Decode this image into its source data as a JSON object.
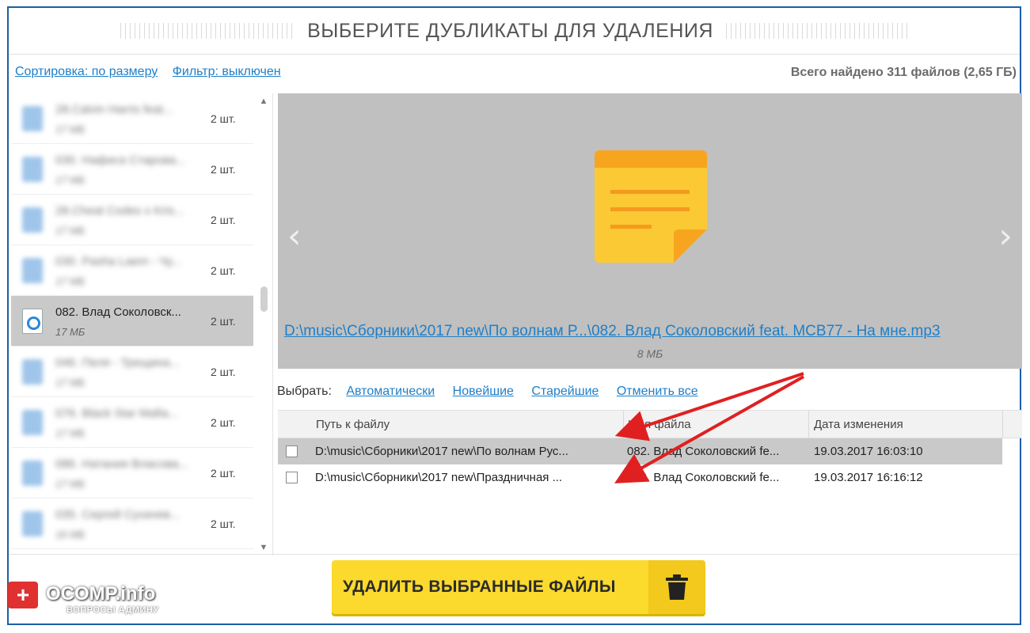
{
  "header": {
    "title": "ВЫБЕРИТЕ ДУБЛИКАТЫ ДЛЯ УДАЛЕНИЯ"
  },
  "toolbar": {
    "sort_link": "Сортировка: по размеру",
    "filter_link": "Фильтр: выключен",
    "total": "Всего найдено 311 файлов (2,65 ГБ)"
  },
  "list": {
    "items": [
      {
        "name": "28.Calvin Harris feat...",
        "size": "17 МБ",
        "count": "2 шт.",
        "blurred": true
      },
      {
        "name": "030. Нафиса Старова...",
        "size": "17 МБ",
        "count": "2 шт.",
        "blurred": true
      },
      {
        "name": "28.Cheat Codes x Kris...",
        "size": "17 МБ",
        "count": "2 шт.",
        "blurred": true
      },
      {
        "name": "030. Pasha Laem - Чу...",
        "size": "17 МБ",
        "count": "2 шт.",
        "blurred": true
      },
      {
        "name": "082. Влад Соколовск...",
        "size": "17 МБ",
        "count": "2 шт.",
        "blurred": false
      },
      {
        "name": "046. Пеля - Трещина...",
        "size": "17 МБ",
        "count": "2 шт.",
        "blurred": true
      },
      {
        "name": "076. Black Star Mafia...",
        "size": "17 МБ",
        "count": "2 шт.",
        "blurred": true
      },
      {
        "name": "086. Натания Власова...",
        "size": "17 МБ",
        "count": "2 шт.",
        "blurred": true
      },
      {
        "name": "035. Сергей Сухачев...",
        "size": "16 МБ",
        "count": "2 шт.",
        "blurred": true
      }
    ],
    "selected_index": 4
  },
  "preview": {
    "path": "D:\\music\\Сборники\\2017 new\\По волнам Р...\\082. Влад Соколовский feat. MCB77 - На мне.mp3",
    "size": "8 МБ",
    "icon": "note-icon"
  },
  "select_bar": {
    "label": "Выбрать:",
    "auto": "Автоматически",
    "newest": "Новейшие",
    "oldest": "Старейшие",
    "cancel": "Отменить все"
  },
  "table": {
    "columns": [
      "Путь к файлу",
      "Имя файла",
      "Дата изменения"
    ],
    "rows": [
      {
        "path": "D:\\music\\Сборники\\2017 new\\По волнам Рус...",
        "name": "082. Влад Соколовский fe...",
        "date": "19.03.2017 16:03:10",
        "checked": false
      },
      {
        "path": "D:\\music\\Сборники\\2017 new\\Праздничная ...",
        "name": "082. Влад Соколовский fe...",
        "date": "19.03.2017 16:16:12",
        "checked": false
      }
    ]
  },
  "actions": {
    "delete_label": "УДАЛИТЬ ВЫБРАННЫЕ ФАЙЛЫ"
  },
  "watermark": {
    "brand": "OCOMP.info",
    "tagline": "ВОПРОСЫ АДМИНУ"
  },
  "colors": {
    "accent": "#fbd92d",
    "link": "#1f7fc7",
    "frame": "#1b5fa8",
    "arrow": "#e02020"
  }
}
